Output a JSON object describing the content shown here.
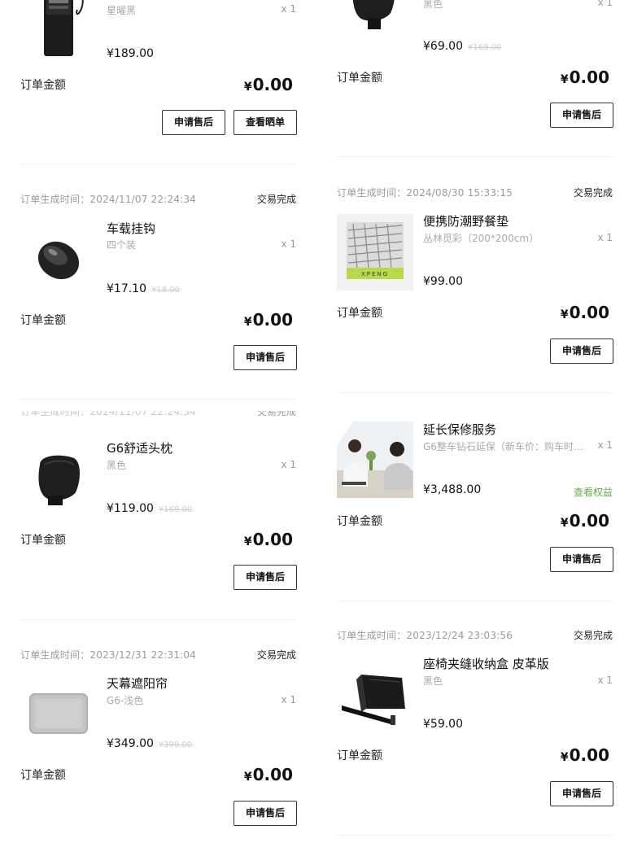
{
  "common": {
    "amount_label": "订单金额",
    "currency": "¥",
    "amount": "0.00",
    "after_sale": "申请售后",
    "view_review": "查看晒单",
    "status_done": "交易完成",
    "qty": "x 1"
  },
  "left": [
    {
      "spec": "星曜黑",
      "price": "¥189.00",
      "thumb_icon": "air-pump-product-icon"
    },
    {
      "time": "订单生成时间：2024/11/07 22:24:34",
      "title": "车载挂钩",
      "spec": "四个装",
      "price": "¥17.10",
      "orig_price": "¥18.00",
      "thumb_icon": "car-hook-product-icon"
    },
    {
      "title": "G6舒适头枕",
      "spec": "黑色",
      "price": "¥119.00",
      "orig_price": "¥169.00",
      "thumb_icon": "headrest-product-icon"
    },
    {
      "time": "订单生成时间：2023/12/31 22:31:04",
      "title": "天幕遮阳帘",
      "spec": "G6-浅色",
      "price": "¥349.00",
      "orig_price": "¥399.00",
      "thumb_icon": "sunshade-product-icon"
    }
  ],
  "right": [
    {
      "spec": "黑色",
      "price": "¥69.00",
      "orig_price": "¥169.00",
      "thumb_icon": "headrest-product-icon"
    },
    {
      "time": "订单生成时间：2024/08/30 15:33:15",
      "title": "便携防潮野餐垫",
      "spec": "丛林觅彩（200*200cm）",
      "price": "¥99.00",
      "thumb_icon": "picnic-mat-product-icon",
      "mat_brand": "XPENG"
    },
    {
      "title": "延长保修服务",
      "spec": "G6整车钻石延保（新车价：购车时…",
      "price": "¥3,488.00",
      "benefit": "查看权益",
      "thumb_icon": "warranty-service-photo"
    },
    {
      "time": "订单生成时间：2023/12/24 23:03:56",
      "title": "座椅夹缝收纳盒 皮革版",
      "spec": "黑色",
      "price": "¥59.00",
      "thumb_icon": "seat-organizer-product-icon"
    }
  ],
  "colors": {
    "benefit_green": "#6aa84f",
    "muted_gray": "#9a9a9a",
    "divider": "#f0f0f0"
  }
}
